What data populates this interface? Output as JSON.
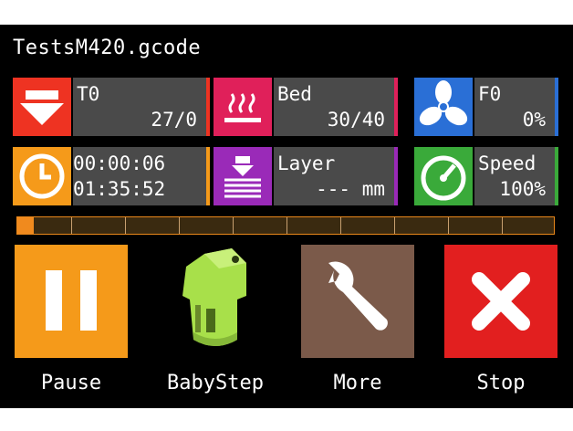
{
  "file": {
    "name": "TestsM420.gcode"
  },
  "tiles": {
    "t0": {
      "label": "T0",
      "value": "27/0"
    },
    "bed": {
      "label": "Bed",
      "value": "30/40"
    },
    "f0": {
      "label": "F0",
      "value": "0%"
    },
    "time": {
      "elapsed": "00:00:06",
      "remaining": "01:35:52"
    },
    "layer": {
      "label": "Layer",
      "value": "--- mm"
    },
    "speed": {
      "label": "Speed",
      "value": "100%"
    }
  },
  "progress": {
    "fraction": 0.03
  },
  "buttons": {
    "pause": "Pause",
    "babystep": "BabyStep",
    "more": "More",
    "stop": "Stop"
  },
  "colors": {
    "t0": "#ee3322",
    "bed": "#e0205a",
    "fan": "#2a6fd6",
    "time": "#f59a1a",
    "layer": "#9a2ab8",
    "speed": "#3aaa3a",
    "pause": "#f59a1a",
    "babystep": "#a8e04a",
    "more": "#7b5a4a",
    "stop": "#e21f1f"
  }
}
